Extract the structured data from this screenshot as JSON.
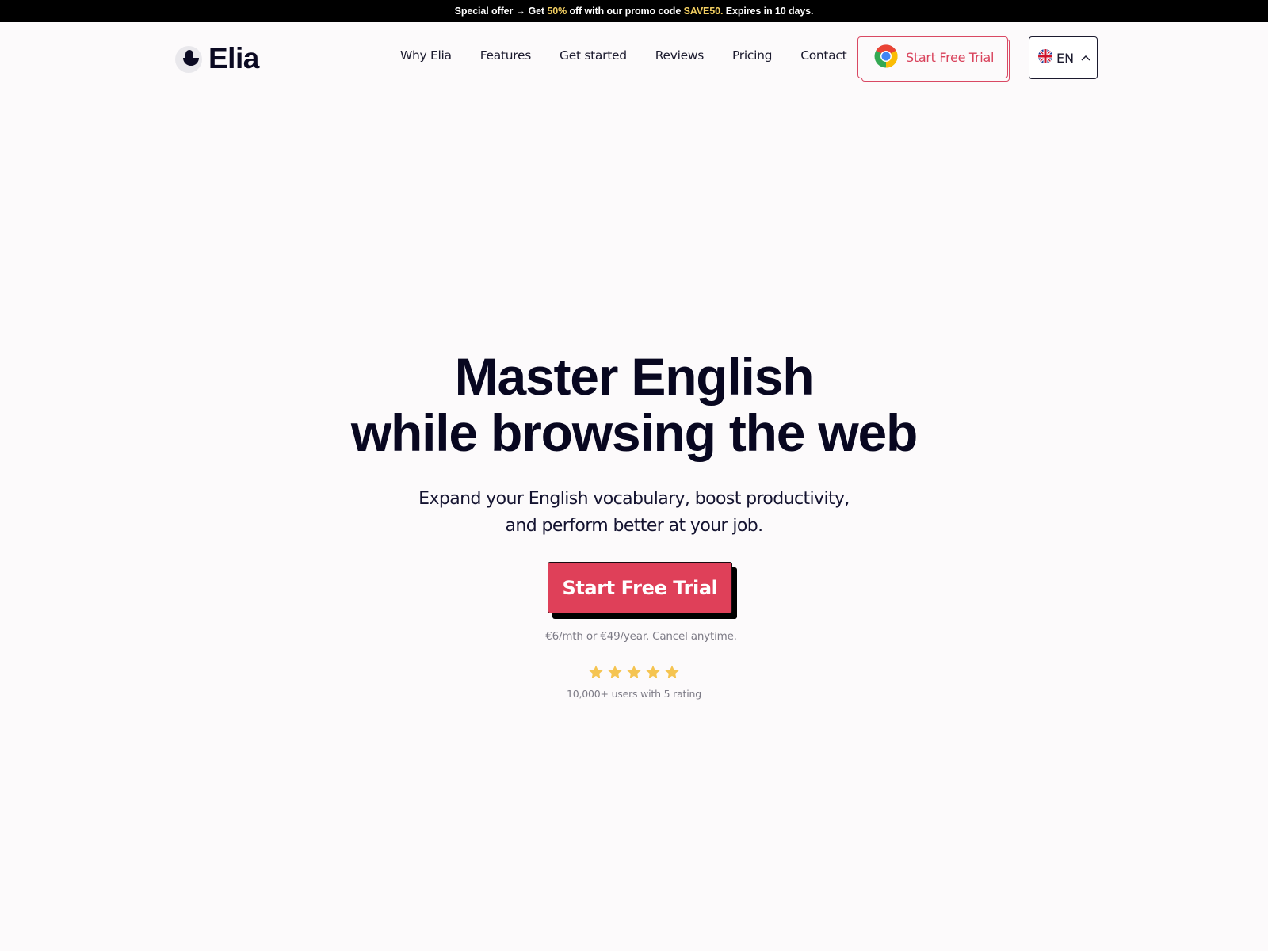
{
  "promo": {
    "prefix": "Special offer → Get ",
    "discount": "50%",
    "middle": " off with our promo code ",
    "code": "SAVE50.",
    "suffix": " Expires in 10 days.",
    "highlight_color": "#f3cf61"
  },
  "header": {
    "logo_text": "Elia",
    "nav": [
      {
        "label": "Why Elia"
      },
      {
        "label": "Features"
      },
      {
        "label": "Get started"
      },
      {
        "label": "Reviews"
      },
      {
        "label": "Pricing"
      },
      {
        "label": "Contact"
      }
    ],
    "trial_button": {
      "label": "Start Free Trial",
      "icon": "chrome-icon"
    },
    "language": {
      "code": "EN",
      "flag": "uk-flag-icon",
      "chevron": "chevron-up-icon"
    }
  },
  "hero": {
    "title_line1": "Master English",
    "title_line2": "while browsing the web",
    "subtitle_line1": "Expand your English vocabulary, boost productivity,",
    "subtitle_line2": "and perform better at your job.",
    "cta_label": "Start Free Trial",
    "price_note": "€6/mth or €49/year. Cancel anytime.",
    "rating": {
      "stars": 5,
      "max": 5,
      "note": "10,000+ users with 5 rating"
    }
  },
  "colors": {
    "accent": "#df4059",
    "text": "#080720",
    "star": "#f5c451",
    "background": "#fcfafb"
  }
}
